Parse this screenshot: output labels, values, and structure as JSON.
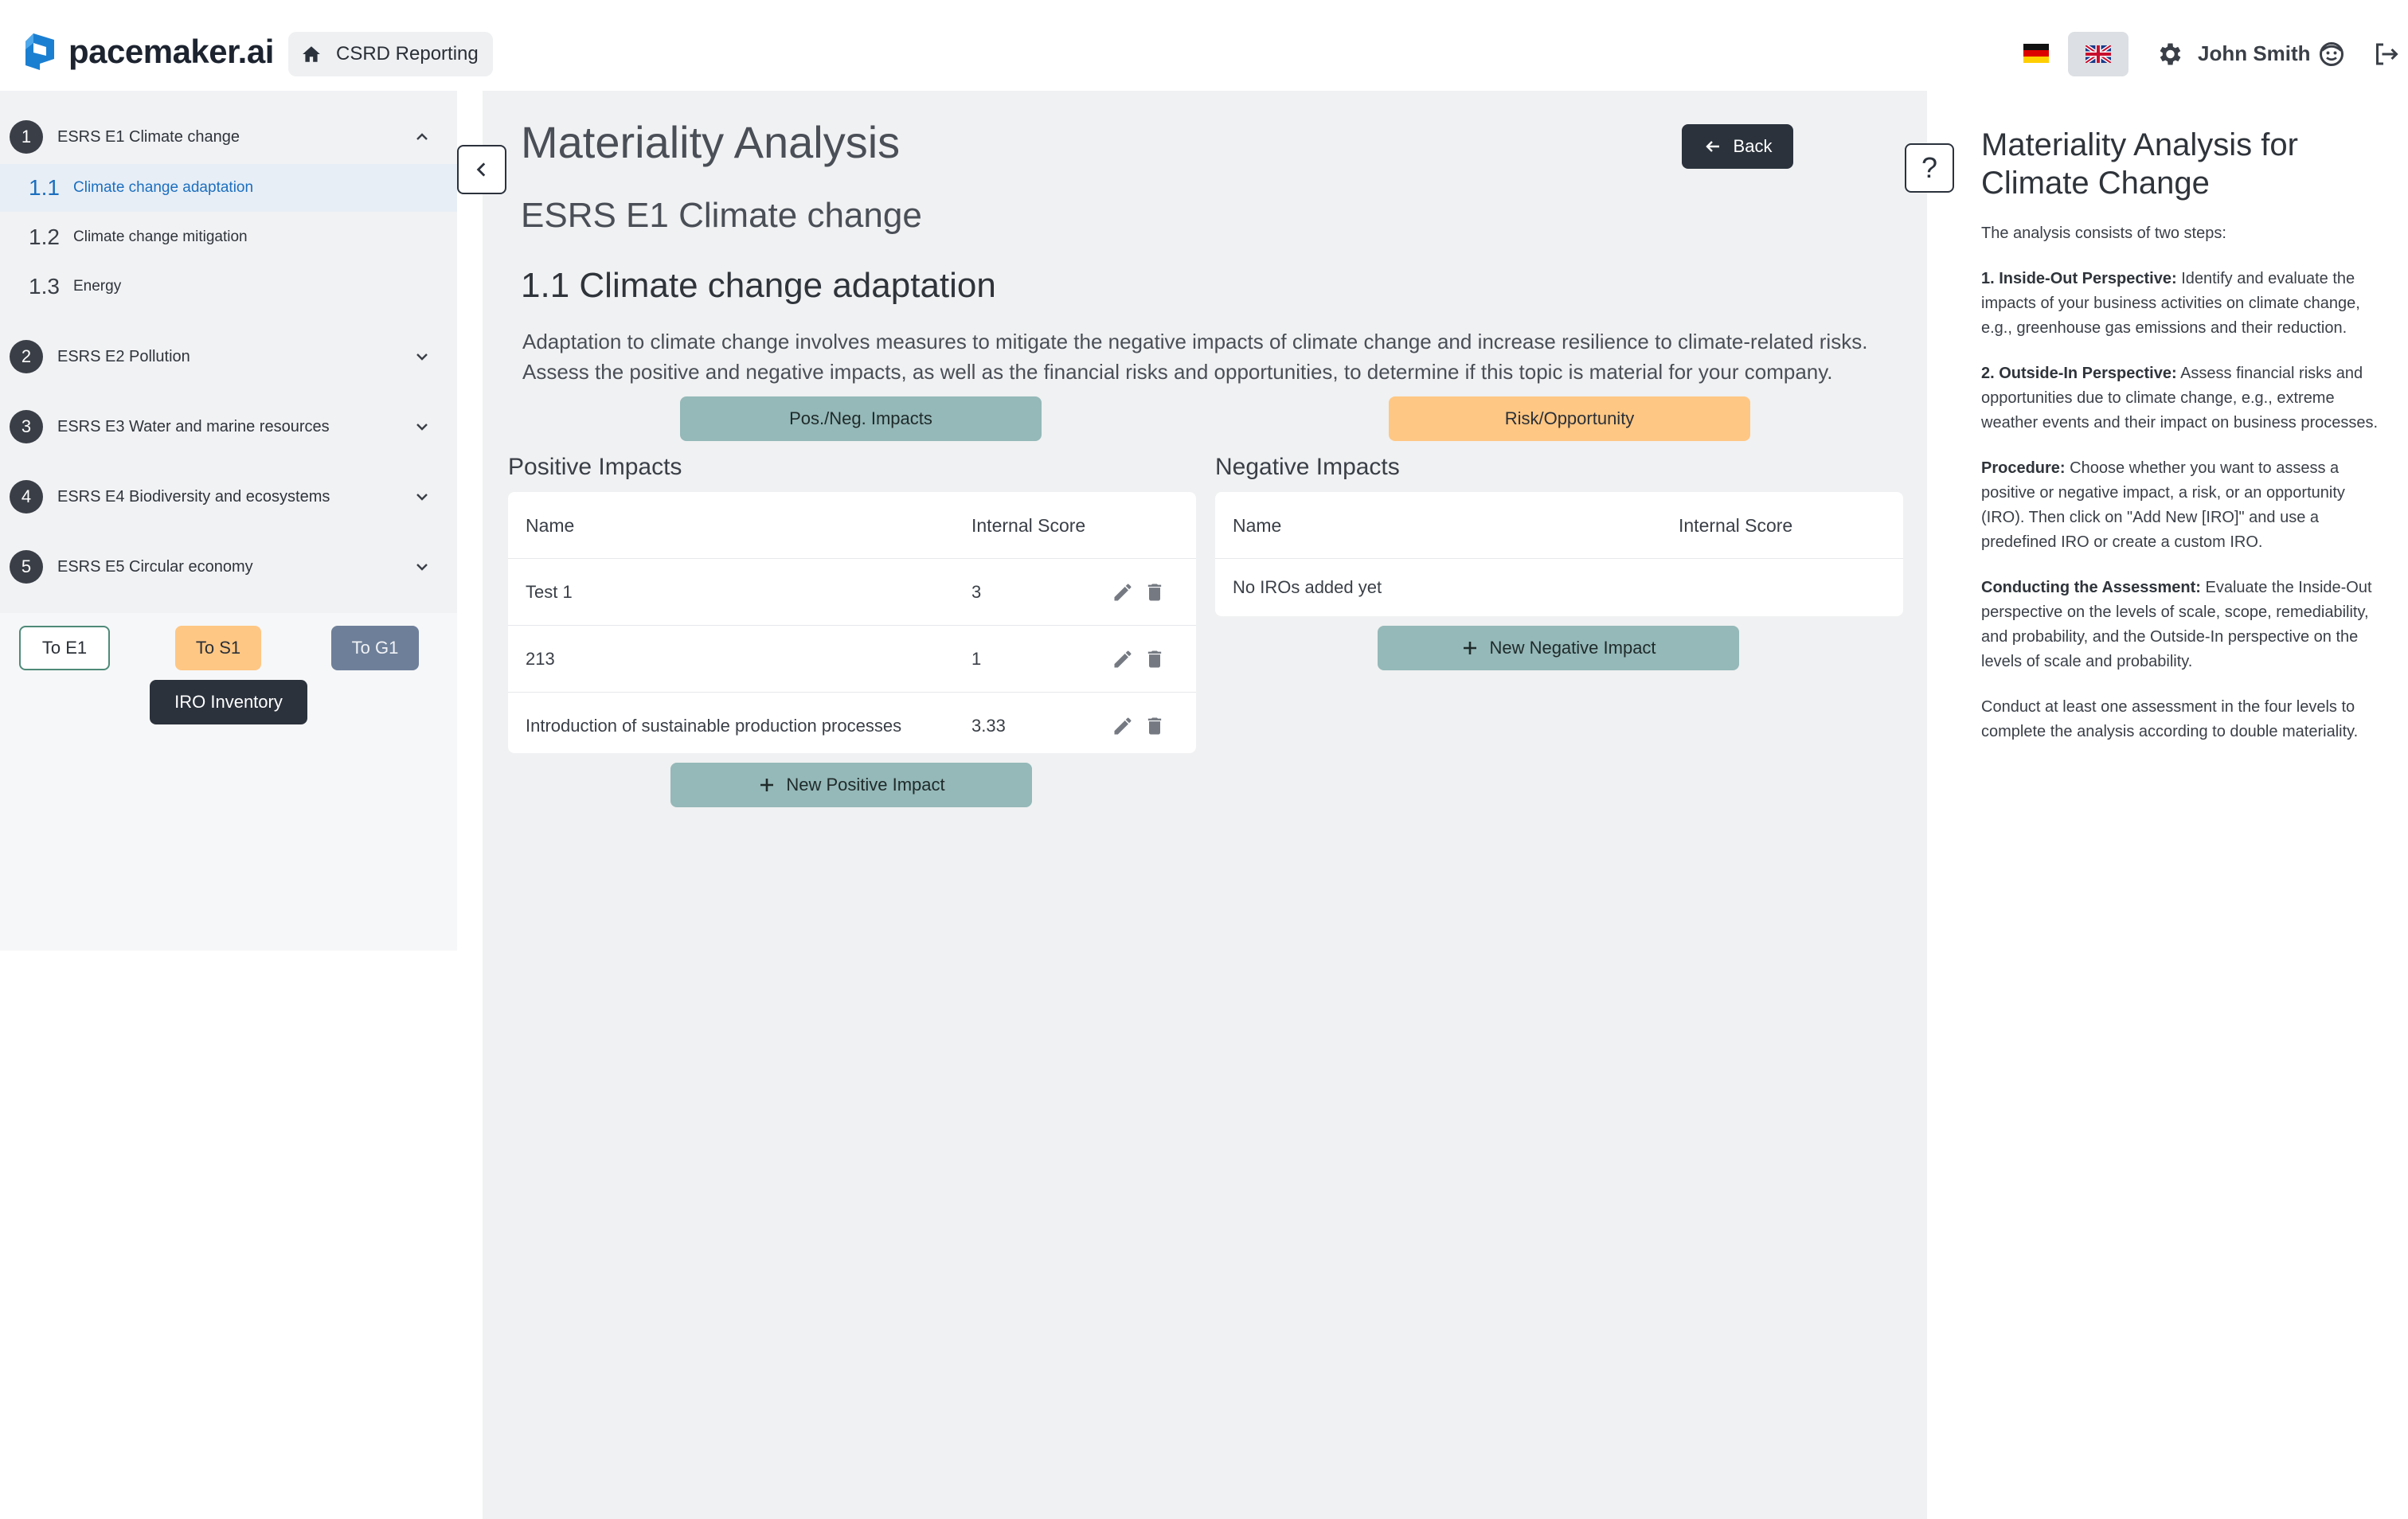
{
  "header": {
    "brand": "pacemaker.ai",
    "home_chip": "CSRD Reporting",
    "user_name": "John Smith",
    "colors": {
      "brand_blue": "#1b7fd1",
      "dark": "#2b323c"
    }
  },
  "sidebar": {
    "sections": [
      {
        "num": "1",
        "label": "ESRS E1 Climate change",
        "expanded": true,
        "items": [
          {
            "num": "1.1",
            "label": "Climate change adaptation",
            "active": true
          },
          {
            "num": "1.2",
            "label": "Climate change mitigation"
          },
          {
            "num": "1.3",
            "label": "Energy"
          }
        ]
      },
      {
        "num": "2",
        "label": "ESRS E2 Pollution"
      },
      {
        "num": "3",
        "label": "ESRS E3 Water and marine resources"
      },
      {
        "num": "4",
        "label": "ESRS E4 Biodiversity and ecosystems"
      },
      {
        "num": "5",
        "label": "ESRS E5 Circular economy"
      }
    ],
    "buttons": {
      "to_e1": "To E1",
      "to_s1": "To S1",
      "to_g1": "To G1",
      "iro_inventory": "IRO Inventory"
    }
  },
  "main": {
    "title": "Materiality Analysis",
    "back_label": "Back",
    "subtitle": "ESRS E1 Climate change",
    "section_title": "1.1 Climate change adaptation",
    "description_line1": "Adaptation to climate change involves measures to mitigate the negative impacts of climate change and increase resilience to climate-related risks.",
    "description_line2": "Assess the positive and negative impacts, as well as the financial risks and opportunities, to determine if this topic is material for your company.",
    "toggle_impacts": "Pos./Neg. Impacts",
    "toggle_risk": "Risk/Opportunity",
    "positive": {
      "title": "Positive Impacts",
      "col_name": "Name",
      "col_score": "Internal Score",
      "rows": [
        {
          "name": "Test 1",
          "score": "3"
        },
        {
          "name": "213",
          "score": "1"
        },
        {
          "name": "Introduction of sustainable production processes",
          "score": "3.33"
        }
      ],
      "add_label": "New Positive Impact"
    },
    "negative": {
      "title": "Negative Impacts",
      "col_name": "Name",
      "col_score": "Internal Score",
      "empty": "No IROs added yet",
      "add_label": "New Negative Impact"
    }
  },
  "help": {
    "button": "?",
    "title": "Materiality Analysis for Climate Change",
    "intro": "The analysis consists of two steps:",
    "p1_bold": "1. Inside-Out Perspective:",
    "p1_text": " Identify and evaluate the impacts of your business activities on climate change, e.g., greenhouse gas emissions and their reduction.",
    "p2_bold": "2. Outside-In Perspective:",
    "p2_text": " Assess financial risks and opportunities due to climate change, e.g., extreme weather events and their impact on business processes.",
    "p3_bold": "Procedure:",
    "p3_text": " Choose whether you want to assess a positive or negative impact, a risk, or an opportunity (IRO). Then click on \"Add New [IRO]\" and use a predefined IRO or create a custom IRO.",
    "p4_bold": "Conducting the Assessment:",
    "p4_text": " Evaluate the Inside-Out perspective on the levels of scale, scope, remediability, and probability, and the Outside-In perspective on the levels of scale and probability.",
    "p5_text": "Conduct at least one assessment in the four levels to complete the analysis according to double materiality."
  }
}
